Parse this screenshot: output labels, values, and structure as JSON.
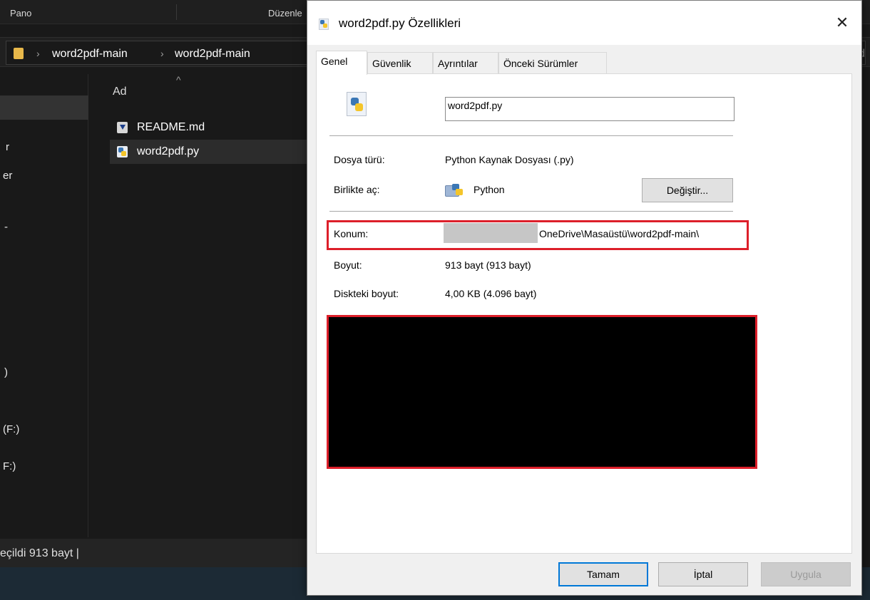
{
  "explorer": {
    "ribbon": {
      "clipboard_label": "Pano",
      "edit_label": "Düzenle"
    },
    "address": {
      "crumbs": [
        "word2pdf-main",
        "word2pdf-main"
      ],
      "right_fragment": "d"
    },
    "nav_fragments": [
      "r",
      "er",
      "-",
      ")",
      "(F:)",
      "F:)"
    ],
    "column_header": "Ad",
    "files": [
      {
        "name": "README.md",
        "icon": "markdown-file-icon"
      },
      {
        "name": "word2pdf.py",
        "icon": "python-file-icon"
      }
    ],
    "status_text": "eçildi  913 bayt  |"
  },
  "dialog": {
    "title": "word2pdf.py Özellikleri",
    "close_glyph": "✕",
    "tabs": [
      "Genel",
      "Güvenlik",
      "Ayrıntılar",
      "Önceki Sürümler"
    ],
    "active_tab": "Genel",
    "file_name": "word2pdf.py",
    "properties": {
      "type_label": "Dosya türü:",
      "type_value": "Python Kaynak Dosyası (.py)",
      "opens_label": "Birlikte aç:",
      "opens_value": "Python",
      "change_button": "Değiştir...",
      "location_label": "Konum:",
      "location_value": "OneDrive\\Masaüstü\\word2pdf-main\\",
      "size_label": "Boyut:",
      "size_value": "913 bayt (913 bayt)",
      "disk_label": "Diskteki boyut:",
      "disk_value": "4,00 KB (4.096 bayt)"
    },
    "buttons": {
      "ok": "Tamam",
      "cancel": "İptal",
      "apply": "Uygula"
    }
  },
  "colors": {
    "highlight": "#dd1f2a",
    "redaction": "#000000",
    "accent": "#0078d7"
  }
}
